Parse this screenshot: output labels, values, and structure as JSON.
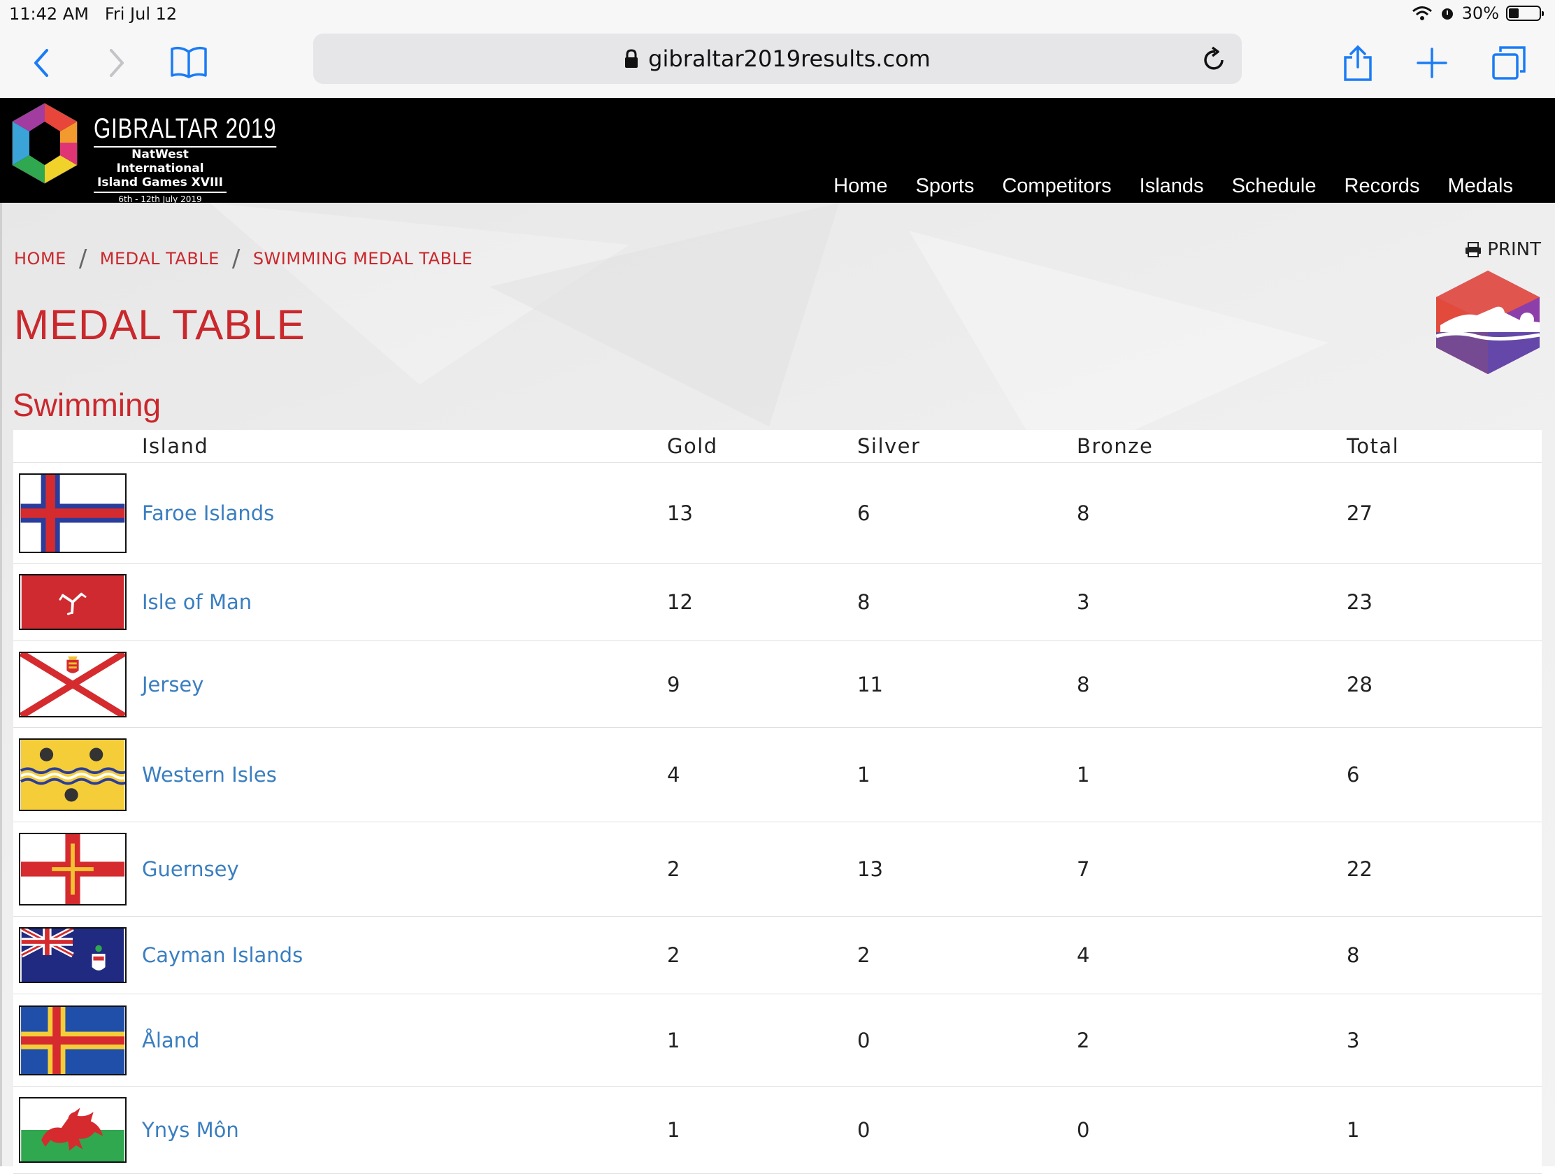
{
  "status_bar": {
    "time": "11:42 AM",
    "date": "Fri Jul 12",
    "battery": "30%"
  },
  "browser": {
    "url": "gibraltar2019results.com"
  },
  "site": {
    "logo_title": "GIBRALTAR 2019",
    "logo_line1": "NatWest International",
    "logo_line2": "Island Games XVIII",
    "logo_dates": "6th - 12th July 2019",
    "nav": [
      "Home",
      "Sports",
      "Competitors",
      "Islands",
      "Schedule",
      "Records",
      "Medals"
    ]
  },
  "breadcrumb": [
    "HOME",
    "MEDAL TABLE",
    "SWIMMING MEDAL TABLE"
  ],
  "print_label": "PRINT",
  "page_title": "MEDAL TABLE",
  "sport": "Swimming",
  "table": {
    "headers": {
      "island": "Island",
      "gold": "Gold",
      "silver": "Silver",
      "bronze": "Bronze",
      "total": "Total"
    },
    "rows": [
      {
        "island": "Faroe Islands",
        "gold": "13",
        "silver": "6",
        "bronze": "8",
        "total": "27",
        "flag": "faroe-flag"
      },
      {
        "island": "Isle of Man",
        "gold": "12",
        "silver": "8",
        "bronze": "3",
        "total": "23",
        "flag": "isle-of-man-flag"
      },
      {
        "island": "Jersey",
        "gold": "9",
        "silver": "11",
        "bronze": "8",
        "total": "28",
        "flag": "jersey-flag"
      },
      {
        "island": "Western Isles",
        "gold": "4",
        "silver": "1",
        "bronze": "1",
        "total": "6",
        "flag": "western-isles-flag"
      },
      {
        "island": "Guernsey",
        "gold": "2",
        "silver": "13",
        "bronze": "7",
        "total": "22",
        "flag": "guernsey-flag"
      },
      {
        "island": "Cayman Islands",
        "gold": "2",
        "silver": "2",
        "bronze": "4",
        "total": "8",
        "flag": "cayman-flag"
      },
      {
        "island": "Åland",
        "gold": "1",
        "silver": "0",
        "bronze": "2",
        "total": "3",
        "flag": "aland-flag"
      },
      {
        "island": "Ynys Môn",
        "gold": "1",
        "silver": "0",
        "bronze": "0",
        "total": "1",
        "flag": "ynys-mon-flag"
      }
    ]
  },
  "colors": {
    "accent_red": "#c9282d",
    "link_blue": "#3a7ec0",
    "header_bg": "#000000"
  }
}
